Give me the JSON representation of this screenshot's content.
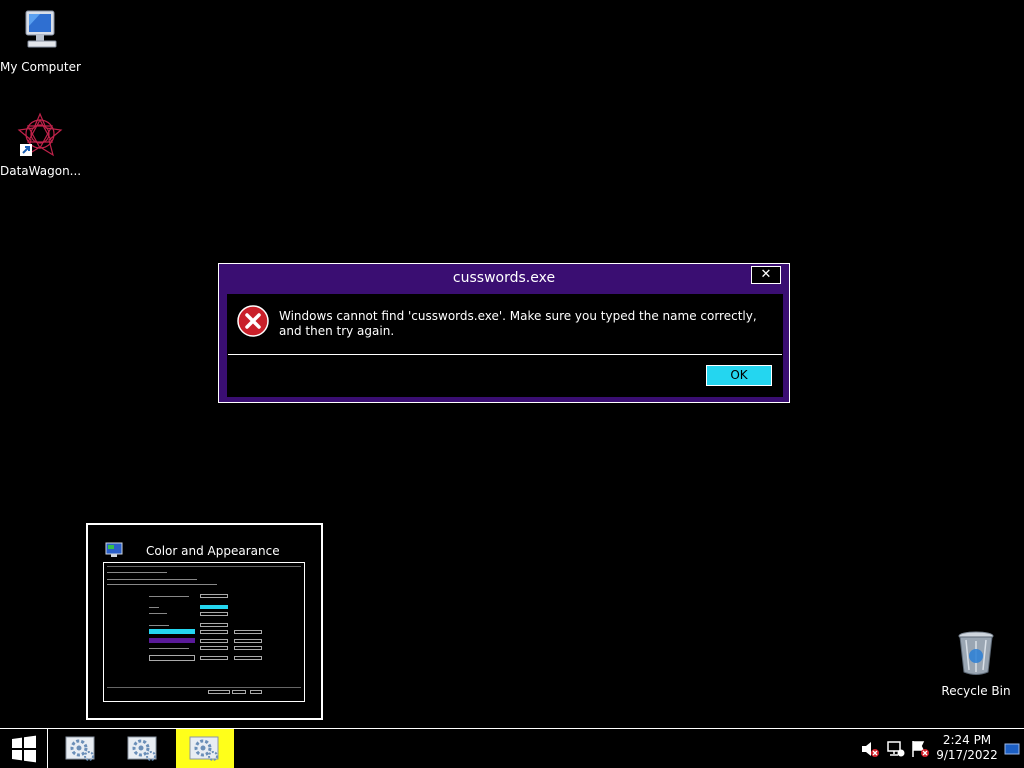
{
  "desktop": {
    "icons": [
      {
        "label": "My Computer",
        "icon": "computer-icon"
      },
      {
        "label": "DataWagon...",
        "icon": "datawagon-icon"
      },
      {
        "label": "Recycle Bin",
        "icon": "recycle-bin-icon"
      }
    ]
  },
  "dialog": {
    "title": "cusswords.exe",
    "close_label": "✕",
    "message": "Windows cannot find 'cusswords.exe'. Make sure you typed the name correctly, and then try again.",
    "ok_label": "OK",
    "icon": "error-icon"
  },
  "thumbnail": {
    "title": "Color and Appearance",
    "icon": "color-appearance-icon"
  },
  "taskbar": {
    "buttons": [
      {
        "icon": "settings-icon",
        "active": false
      },
      {
        "icon": "settings-icon",
        "active": false
      },
      {
        "icon": "settings-icon",
        "active": true
      }
    ],
    "clock": {
      "time": "2:24 PM",
      "date": "9/17/2022"
    }
  },
  "colors": {
    "dialog_frame": "#3a0e72",
    "ok_button": "#24d6f0",
    "active_taskbar": "#ffff1a"
  }
}
